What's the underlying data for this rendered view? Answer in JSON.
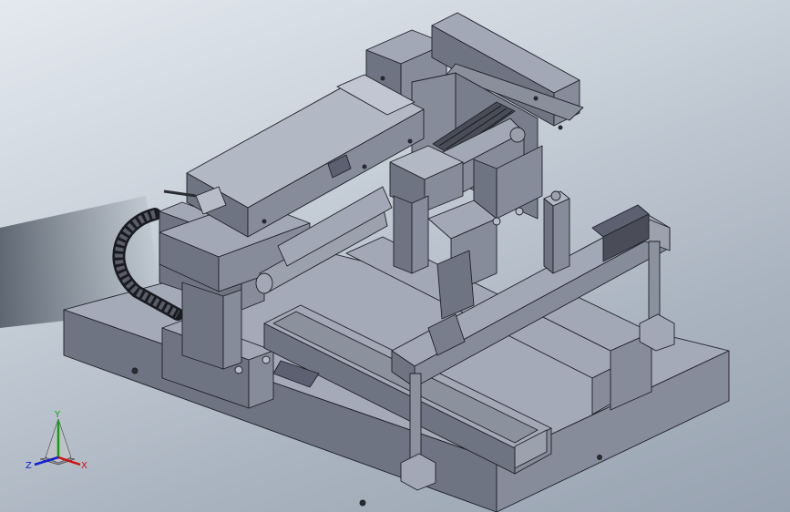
{
  "viewport": {
    "background_top": "#e4e9ef",
    "background_bottom": "#98a3b1"
  },
  "triad": {
    "x_label": "X",
    "y_label": "Y",
    "z_label": "Z",
    "x_color": "#d01010",
    "y_color": "#10a010",
    "z_color": "#1020d0"
  },
  "model_colors": {
    "face_top": "#a3a8b6",
    "face_left": "#6f7482",
    "face_right": "#878c9a",
    "edge": "#1e2028"
  }
}
